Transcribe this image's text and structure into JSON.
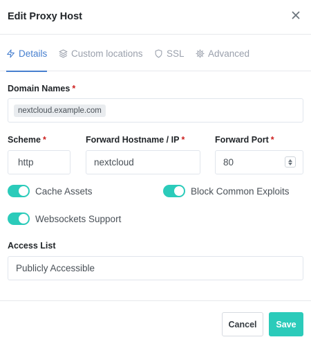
{
  "modal": {
    "title": "Edit Proxy Host"
  },
  "tabs": [
    {
      "label": "Details",
      "icon": "zap-icon",
      "active": true
    },
    {
      "label": "Custom locations",
      "icon": "layers-icon",
      "active": false
    },
    {
      "label": "SSL",
      "icon": "shield-icon",
      "active": false
    },
    {
      "label": "Advanced",
      "icon": "gear-icon",
      "active": false
    }
  ],
  "form": {
    "domain_names": {
      "label": "Domain Names",
      "required": "*",
      "values": [
        "nextcloud.example.com"
      ]
    },
    "scheme": {
      "label": "Scheme",
      "required": "*",
      "value": "http"
    },
    "forward_host": {
      "label": "Forward Hostname / IP",
      "required": "*",
      "value": "nextcloud"
    },
    "forward_port": {
      "label": "Forward Port",
      "required": "*",
      "value": "80"
    },
    "toggles": {
      "cache_assets": {
        "label": "Cache Assets",
        "on": true
      },
      "block_exploits": {
        "label": "Block Common Exploits",
        "on": true
      },
      "websockets": {
        "label": "Websockets Support",
        "on": true
      }
    },
    "access_list": {
      "label": "Access List",
      "value": "Publicly Accessible"
    }
  },
  "footer": {
    "cancel_label": "Cancel",
    "save_label": "Save"
  },
  "colors": {
    "accent": "#467fcf",
    "teal": "#2bcbba",
    "required": "#cd201f"
  }
}
